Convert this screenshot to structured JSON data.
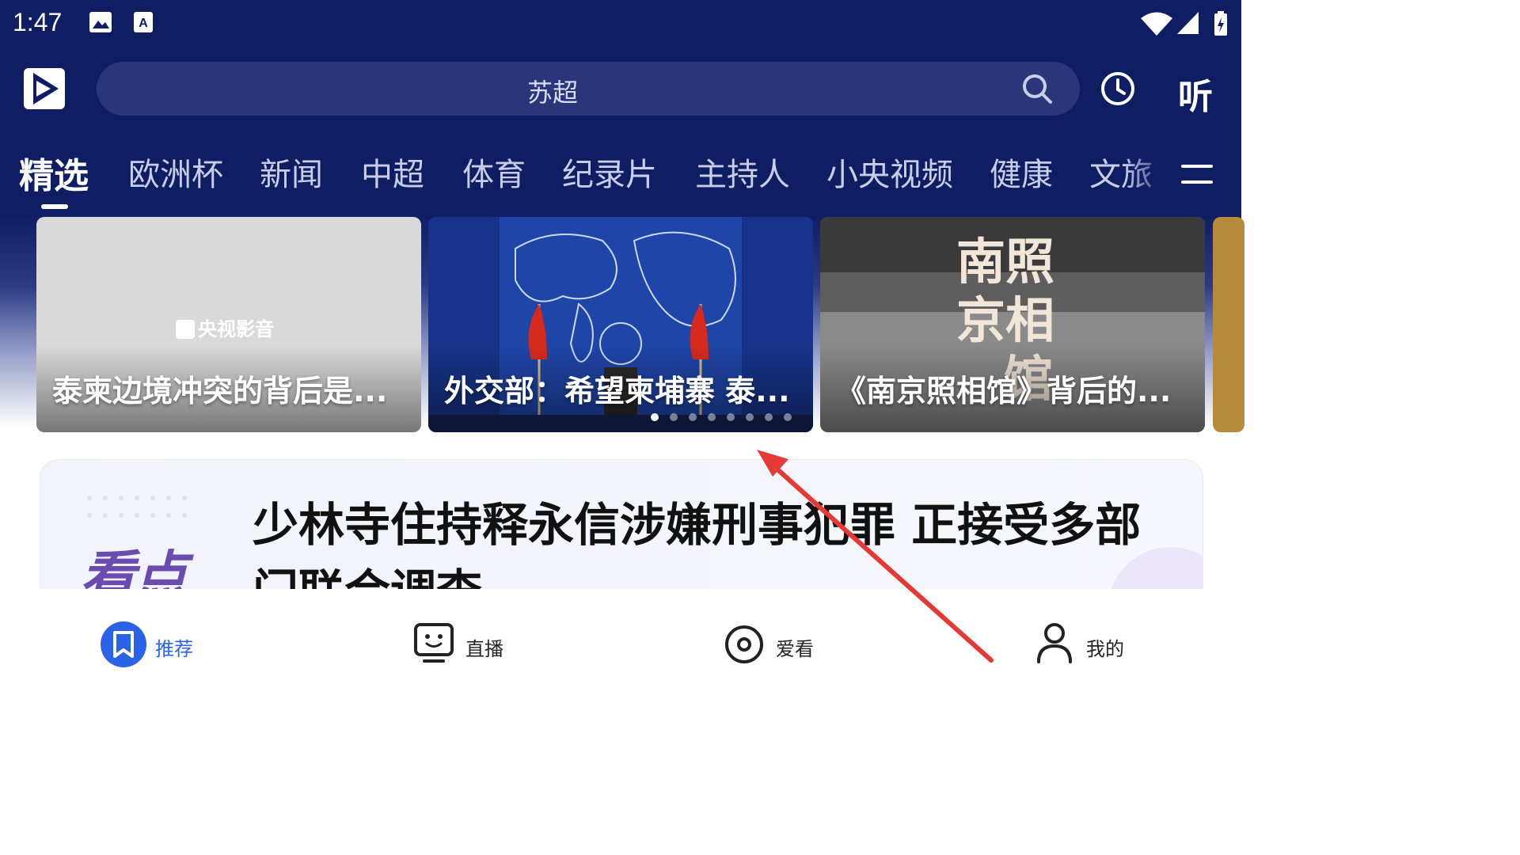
{
  "status_bar": {
    "time": "1:47"
  },
  "header": {
    "search_placeholder": "苏超",
    "listen_label": "听",
    "logo_icon": "cctv-video-logo-icon"
  },
  "tabs": [
    {
      "label": "精选",
      "active": true
    },
    {
      "label": "欧洲杯"
    },
    {
      "label": "新闻"
    },
    {
      "label": "中超"
    },
    {
      "label": "体育"
    },
    {
      "label": "纪录片"
    },
    {
      "label": "主持人"
    },
    {
      "label": "小央视频"
    },
    {
      "label": "健康"
    },
    {
      "label": "文旅"
    }
  ],
  "carousel": {
    "cards": [
      {
        "title": "泰柬边境冲突的背后是...",
        "placeholder_logo": "央视影音"
      },
      {
        "title": "外交部：希望柬埔寨 泰..."
      },
      {
        "title": "《南京照相馆》背后的...",
        "poster_text": [
          "南",
          "照",
          "京",
          "相",
          "馆"
        ]
      }
    ],
    "dot_count": 8,
    "active_dot": 0
  },
  "highlight": {
    "badge": "看点",
    "title": "少林寺住持释永信涉嫌刑事犯罪 正接受多部门联合调查"
  },
  "bottom_nav": [
    {
      "label": "推荐",
      "icon": "bookmark-icon",
      "active": true
    },
    {
      "label": "直播",
      "icon": "tv-icon"
    },
    {
      "label": "爱看",
      "icon": "disc-icon"
    },
    {
      "label": "我的",
      "icon": "user-icon"
    }
  ],
  "colors": {
    "header_bg": "#0f1d63",
    "search_bg": "#2a3679",
    "accent": "#2a63e8",
    "annotation_arrow": "#e53935"
  }
}
